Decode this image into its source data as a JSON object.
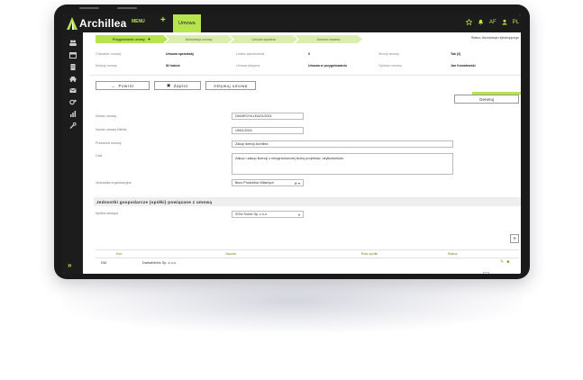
{
  "app": {
    "logo_text": "Archillea",
    "menu_label": "MENU",
    "plus_label": "+",
    "active_tab": "Umowa",
    "user_initials": "AF",
    "language": "PL"
  },
  "stepper": {
    "steps": [
      "Przygotowanie umowy",
      "Akceptacja umowy",
      "Umowa wysłana",
      "Umowa zawarta"
    ],
    "status_text": "Status: Akceptacja rejestrującego"
  },
  "info": [
    {
      "label": "Charakter umowy",
      "value": "Umowa sprzedaży",
      "label2": "Liczba zakończenia",
      "value2": "0",
      "label3": "Strony umowy",
      "value3": "Tak (2)"
    },
    {
      "label": "Moduły umowy",
      "value": "W trakcie",
      "label2": "Umowa aktywna",
      "value2": "Umowa w przygotowaniu",
      "label3": "Opiekun umowy",
      "value3": "Jan Kowalewski"
    }
  ],
  "buttons": {
    "back": "Powrót",
    "save": "Zapisz",
    "activate": "Aktywuj umowę",
    "generate": "Generuj"
  },
  "form": {
    "contract_number_label": "Numer umowy",
    "contract_number_value": "DM/ARCHILLEA/01/2024",
    "client_number_label": "Numer umowy klienta",
    "client_number_value": "UM01/2024",
    "subject_label": "Przedmiot umowy",
    "subject_value": "Zakup licencji Archillea",
    "goal_label": "Cele",
    "goal_value": "Zakup i zakup licencji z nieograniczonej liczby projektów, użytkowników.",
    "org_unit_label": "Jednostka organizacyjna",
    "org_unit_value": "Biuro Produktów Własnych",
    "section_title": "Jednostki gospodarcze (spółki) powiązane z umową",
    "lead_company_label": "Spółka wiodąca",
    "lead_company_value": "SOW Solver Sp. z o.o."
  },
  "table": {
    "headers": [
      "Kod",
      "Nazwa",
      "Rola spółki",
      "Status"
    ],
    "rows": [
      {
        "code": "DM",
        "name": "DarbaMetric Sp. z o.o.",
        "role": "",
        "status": ""
      }
    ]
  },
  "pager": {
    "prev": "‹",
    "page": "1",
    "of": "z 1",
    "next": "›"
  },
  "colors": {
    "accent": "#b7e44c",
    "dark": "#1c1c1c"
  }
}
